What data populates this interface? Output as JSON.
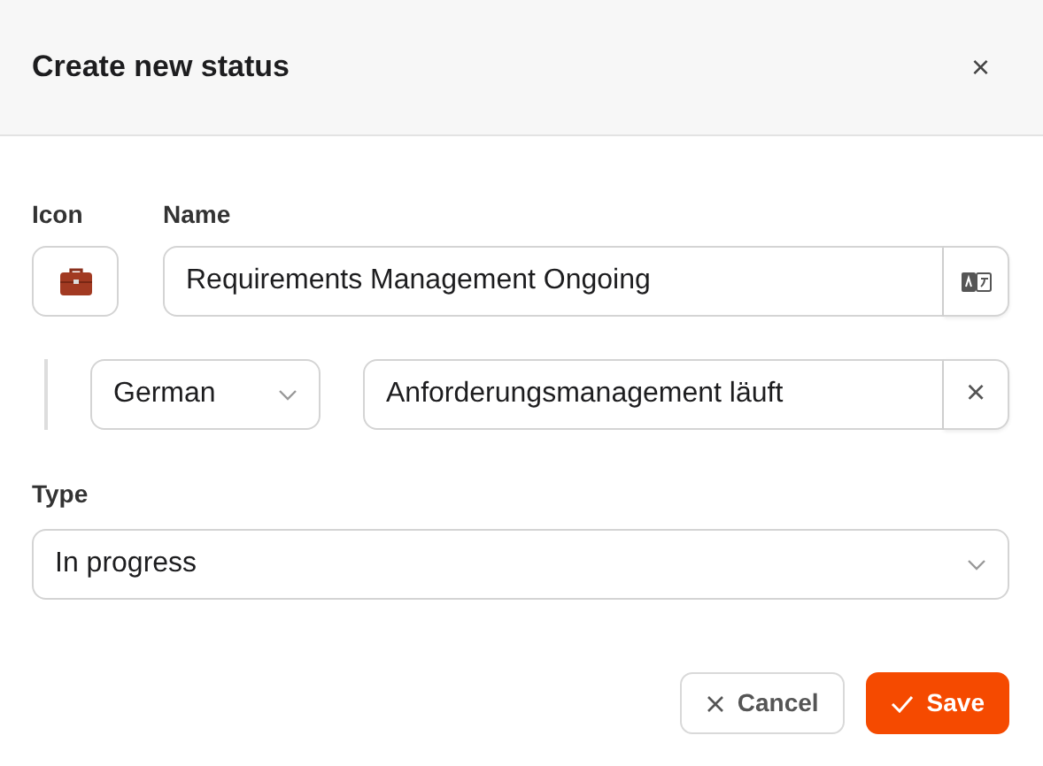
{
  "dialog": {
    "title": "Create new status",
    "close": "×"
  },
  "icon_label": "Icon",
  "name_label": "Name",
  "name_value": "Requirements Management Ongoing",
  "translations": [
    {
      "language": "German",
      "value": "Anforderungsmanagement läuft",
      "remove": "×"
    }
  ],
  "type_label": "Type",
  "type_value": "In progress",
  "buttons": [
    {
      "kind": "cancel",
      "label": "Cancel"
    },
    {
      "kind": "save",
      "label": "Save"
    }
  ]
}
